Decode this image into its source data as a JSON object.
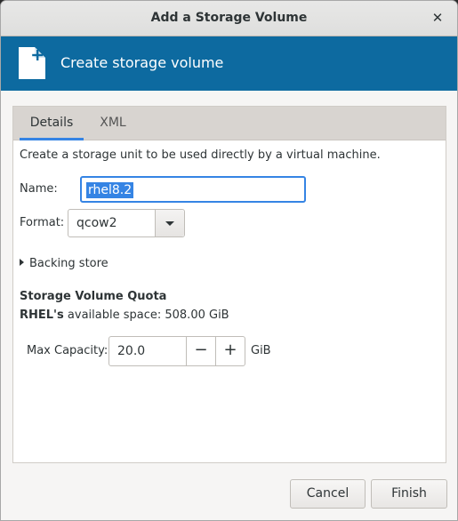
{
  "window": {
    "title": "Add a Storage Volume"
  },
  "banner": {
    "title": "Create storage volume"
  },
  "tabs": [
    {
      "label": "Details"
    },
    {
      "label": "XML"
    }
  ],
  "details": {
    "description": "Create a storage unit to be used directly by a virtual machine.",
    "name_label": "Name:",
    "name_value": "rhel8.2",
    "format_label": "Format:",
    "format_value": "qcow2",
    "backing_store_label": "Backing store",
    "quota_title": "Storage Volume Quota",
    "pool_name": "RHEL's",
    "available_text": " available space: 508.00 GiB",
    "max_capacity_label": "Max Capacity:",
    "max_capacity_value": "20.0",
    "decrement": "−",
    "increment": "+",
    "capacity_unit": "GiB"
  },
  "buttons": {
    "cancel": "Cancel",
    "finish": "Finish"
  },
  "icons": {
    "close": "close-icon",
    "banner": "new-document-icon",
    "format_dropdown": "chevron-down-icon",
    "backing_store": "expander-arrow-icon"
  },
  "colors": {
    "banner": "#0d6aa0",
    "accent": "#3584e4"
  }
}
